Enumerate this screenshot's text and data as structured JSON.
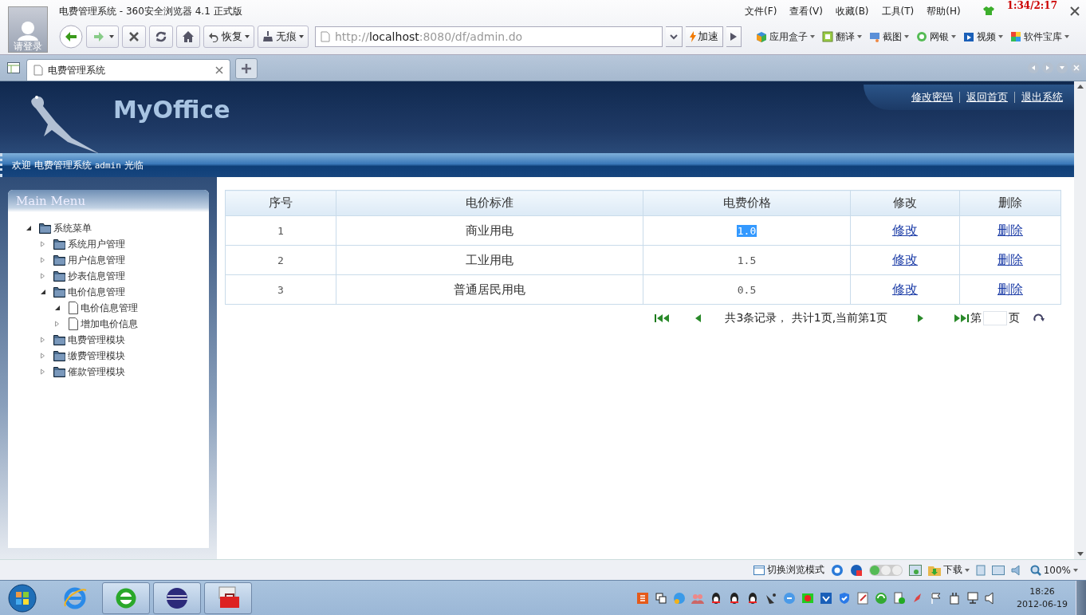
{
  "browser": {
    "title": "电费管理系统 - 360安全浏览器 4.1 正式版",
    "login_label": "请登录",
    "menu": [
      "文件(F)",
      "查看(V)",
      "收藏(B)",
      "工具(T)",
      "帮助(H)"
    ],
    "overlay_time": "1:34/2:17",
    "restore_label": "恢复",
    "incognito_label": "无痕",
    "address": {
      "scheme": "http://",
      "host": "localhost",
      "rest": ":8080/df/admin.do"
    },
    "accelerate_label": "加速",
    "toolbar_links": [
      {
        "label": "应用盒子",
        "kind": "box"
      },
      {
        "label": "翻译",
        "kind": "translate"
      },
      {
        "label": "截图",
        "kind": "screenshot"
      },
      {
        "label": "网银",
        "kind": "bank"
      },
      {
        "label": "视频",
        "kind": "video"
      },
      {
        "label": "软件宝库",
        "kind": "store"
      }
    ],
    "tabs": [
      {
        "label": "电费管理系统",
        "selected": true
      }
    ]
  },
  "page": {
    "logo": "MyOffice",
    "header_links": [
      "修改密码",
      "返回首页",
      "退出系统"
    ],
    "welcome": {
      "prefix": "欢迎 电费管理系统",
      "user": "admin",
      "suffix": "光临"
    },
    "menu": {
      "title": "Main Menu",
      "tree": [
        {
          "label": "系统菜单",
          "kind": "folder",
          "expanded": true,
          "children": [
            {
              "label": "系统用户管理",
              "kind": "folder",
              "expanded": false
            },
            {
              "label": "用户信息管理",
              "kind": "folder",
              "expanded": false
            },
            {
              "label": "抄表信息管理",
              "kind": "folder",
              "expanded": false
            },
            {
              "label": "电价信息管理",
              "kind": "folder",
              "expanded": true,
              "children": [
                {
                  "label": "电价信息管理",
                  "kind": "page",
                  "expanded": true
                },
                {
                  "label": "增加电价信息",
                  "kind": "page",
                  "expanded": false
                }
              ]
            },
            {
              "label": "电费管理模块",
              "kind": "folder",
              "expanded": false
            },
            {
              "label": "缴费管理模块",
              "kind": "folder",
              "expanded": false
            },
            {
              "label": "催款管理模块",
              "kind": "folder",
              "expanded": false
            }
          ]
        }
      ]
    },
    "table": {
      "columns": [
        "序号",
        "电价标准",
        "电费价格",
        "修改",
        "删除"
      ],
      "rows": [
        {
          "no": "1",
          "standard": "商业用电",
          "price": "1.0",
          "price_selected": true,
          "edit": "修改",
          "delete": "删除"
        },
        {
          "no": "2",
          "standard": "工业用电",
          "price": "1.5",
          "price_selected": false,
          "edit": "修改",
          "delete": "删除"
        },
        {
          "no": "3",
          "standard": "普通居民用电",
          "price": "0.5",
          "price_selected": false,
          "edit": "修改",
          "delete": "删除"
        }
      ]
    },
    "pager": {
      "summary": "共3条记录， 共计1页,当前第1页",
      "page_prefix": "第",
      "page_suffix": "页"
    }
  },
  "status_bar": {
    "mode_label": "切换浏览模式",
    "download_label": "下载",
    "zoom": "100%"
  },
  "taskbar": {
    "apps": [
      {
        "kind": "ie",
        "open": false
      },
      {
        "kind": "browser360",
        "open": true
      },
      {
        "kind": "eclipse",
        "open": true
      },
      {
        "kind": "toolbox",
        "open": true
      }
    ],
    "time": "18:26",
    "date": "2012-06-19"
  }
}
